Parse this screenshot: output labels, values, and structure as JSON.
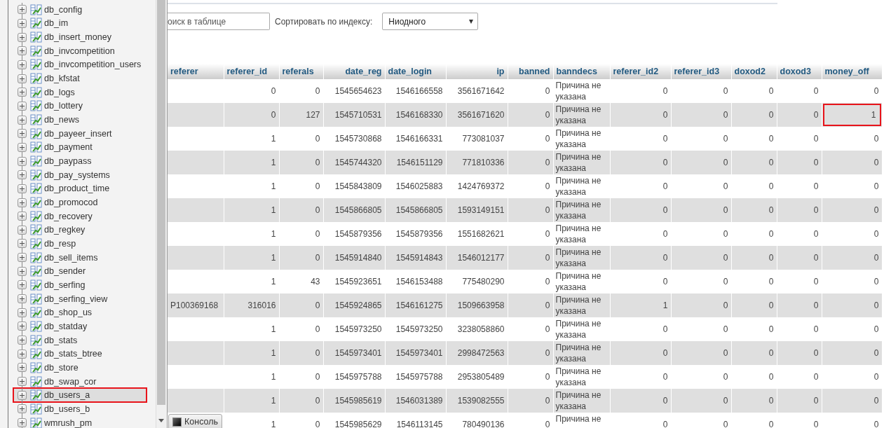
{
  "sidebar": {
    "items": [
      {
        "label": "db_config",
        "selected": false,
        "outlined": false
      },
      {
        "label": "db_im",
        "selected": false,
        "outlined": false
      },
      {
        "label": "db_insert_money",
        "selected": false,
        "outlined": false
      },
      {
        "label": "db_invcompetition",
        "selected": false,
        "outlined": false
      },
      {
        "label": "db_invcompetition_users",
        "selected": false,
        "outlined": false
      },
      {
        "label": "db_kfstat",
        "selected": false,
        "outlined": false
      },
      {
        "label": "db_logs",
        "selected": false,
        "outlined": false
      },
      {
        "label": "db_lottery",
        "selected": false,
        "outlined": false
      },
      {
        "label": "db_news",
        "selected": false,
        "outlined": false
      },
      {
        "label": "db_payeer_insert",
        "selected": false,
        "outlined": false
      },
      {
        "label": "db_payment",
        "selected": false,
        "outlined": false
      },
      {
        "label": "db_paypass",
        "selected": false,
        "outlined": false
      },
      {
        "label": "db_pay_systems",
        "selected": false,
        "outlined": false
      },
      {
        "label": "db_product_time",
        "selected": false,
        "outlined": false
      },
      {
        "label": "db_promocod",
        "selected": false,
        "outlined": false
      },
      {
        "label": "db_recovery",
        "selected": false,
        "outlined": false
      },
      {
        "label": "db_regkey",
        "selected": false,
        "outlined": false
      },
      {
        "label": "db_resp",
        "selected": false,
        "outlined": false
      },
      {
        "label": "db_sell_items",
        "selected": false,
        "outlined": false
      },
      {
        "label": "db_sender",
        "selected": false,
        "outlined": false
      },
      {
        "label": "db_serfing",
        "selected": false,
        "outlined": false
      },
      {
        "label": "db_serfing_view",
        "selected": false,
        "outlined": false
      },
      {
        "label": "db_shop_us",
        "selected": false,
        "outlined": false
      },
      {
        "label": "db_statday",
        "selected": false,
        "outlined": false
      },
      {
        "label": "db_stats",
        "selected": false,
        "outlined": false
      },
      {
        "label": "db_stats_btree",
        "selected": false,
        "outlined": false
      },
      {
        "label": "db_store",
        "selected": false,
        "outlined": false
      },
      {
        "label": "db_swap_cor",
        "selected": false,
        "outlined": false
      },
      {
        "label": "db_users_a",
        "selected": true,
        "outlined": true
      },
      {
        "label": "db_users_b",
        "selected": false,
        "outlined": false
      },
      {
        "label": "wmrush_pm",
        "selected": false,
        "outlined": false
      }
    ]
  },
  "toolbar": {
    "search": {
      "placeholder": "оиск в таблице"
    },
    "sort_label": "Сортировать по индексу:",
    "sort_select": {
      "value": "Ниодного"
    }
  },
  "table": {
    "columns": [
      "referer",
      "referer_id",
      "referals",
      "date_reg",
      "date_login",
      "ip",
      "banned",
      "banndecs",
      "referer_id2",
      "referer_id3",
      "doxod2",
      "doxod3",
      "money_off"
    ],
    "rows": [
      {
        "cells": [
          "",
          "0",
          "0",
          "1545654623",
          "1546166558",
          "3561671642",
          "0",
          "Причина не указана",
          "0",
          "0",
          "0",
          "0",
          "0"
        ]
      },
      {
        "cells": [
          "",
          "0",
          "127",
          "1545710531",
          "1546168330",
          "3561671620",
          "0",
          "Причина не указана",
          "0",
          "0",
          "0",
          "0",
          {
            "text": "1",
            "outlined": true
          }
        ]
      },
      {
        "cells": [
          "",
          "1",
          "0",
          "1545730868",
          "1546166331",
          "773081037",
          "0",
          "Причина не указана",
          "0",
          "0",
          "0",
          "0",
          "0"
        ]
      },
      {
        "cells": [
          "",
          "1",
          "0",
          "1545744320",
          "1546151129",
          "771810336",
          "0",
          "Причина не указана",
          "0",
          "0",
          "0",
          "0",
          "0"
        ]
      },
      {
        "cells": [
          "",
          "1",
          "0",
          "1545843809",
          "1546025883",
          "1424769372",
          "0",
          "Причина не указана",
          "0",
          "0",
          "0",
          "0",
          "0"
        ]
      },
      {
        "cells": [
          "",
          "1",
          "0",
          "1545866805",
          "1545866805",
          "1593149151",
          "0",
          "Причина не указана",
          "0",
          "0",
          "0",
          "0",
          "0"
        ]
      },
      {
        "cells": [
          "",
          "1",
          "0",
          "1545879356",
          "1545879356",
          "1551682621",
          "0",
          "Причина не указана",
          "0",
          "0",
          "0",
          "0",
          "0"
        ]
      },
      {
        "cells": [
          "",
          "1",
          "0",
          "1545914840",
          "1545914843",
          "1546012177",
          "0",
          "Причина не указана",
          "0",
          "0",
          "0",
          "0",
          "0"
        ]
      },
      {
        "cells": [
          "",
          "1",
          "43",
          "1545923651",
          "1546153488",
          "775480290",
          "0",
          "Причина не указана",
          "0",
          "0",
          "0",
          "0",
          "0"
        ]
      },
      {
        "cells": [
          "P100369168",
          "316016",
          "0",
          "1545924865",
          "1546161275",
          "1509663958",
          "0",
          "Причина не указана",
          "1",
          "0",
          "0",
          "0",
          "0"
        ]
      },
      {
        "cells": [
          "",
          "1",
          "0",
          "1545973250",
          "1545973250",
          "3238058860",
          "0",
          "Причина не указана",
          "0",
          "0",
          "0",
          "0",
          "0"
        ]
      },
      {
        "cells": [
          "",
          "1",
          "0",
          "1545973401",
          "1545973401",
          "2998472563",
          "0",
          "Причина не указана",
          "0",
          "0",
          "0",
          "0",
          "0"
        ]
      },
      {
        "cells": [
          "",
          "1",
          "0",
          "1545975788",
          "1545975788",
          "2953805489",
          "0",
          "Причина не указана",
          "0",
          "0",
          "0",
          "0",
          "0"
        ]
      },
      {
        "cells": [
          "",
          "1",
          "0",
          "1545985619",
          "1546031389",
          "1539082555",
          "0",
          "Причина не указана",
          "0",
          "0",
          "0",
          "0",
          "0"
        ]
      },
      {
        "cells": [
          "",
          "1",
          "0",
          "1545985629",
          "1546113145",
          "780490136",
          "0",
          "Причина не",
          "0",
          "0",
          "0",
          "0",
          "0"
        ]
      }
    ]
  },
  "console_tab": {
    "label": "Консоль"
  }
}
